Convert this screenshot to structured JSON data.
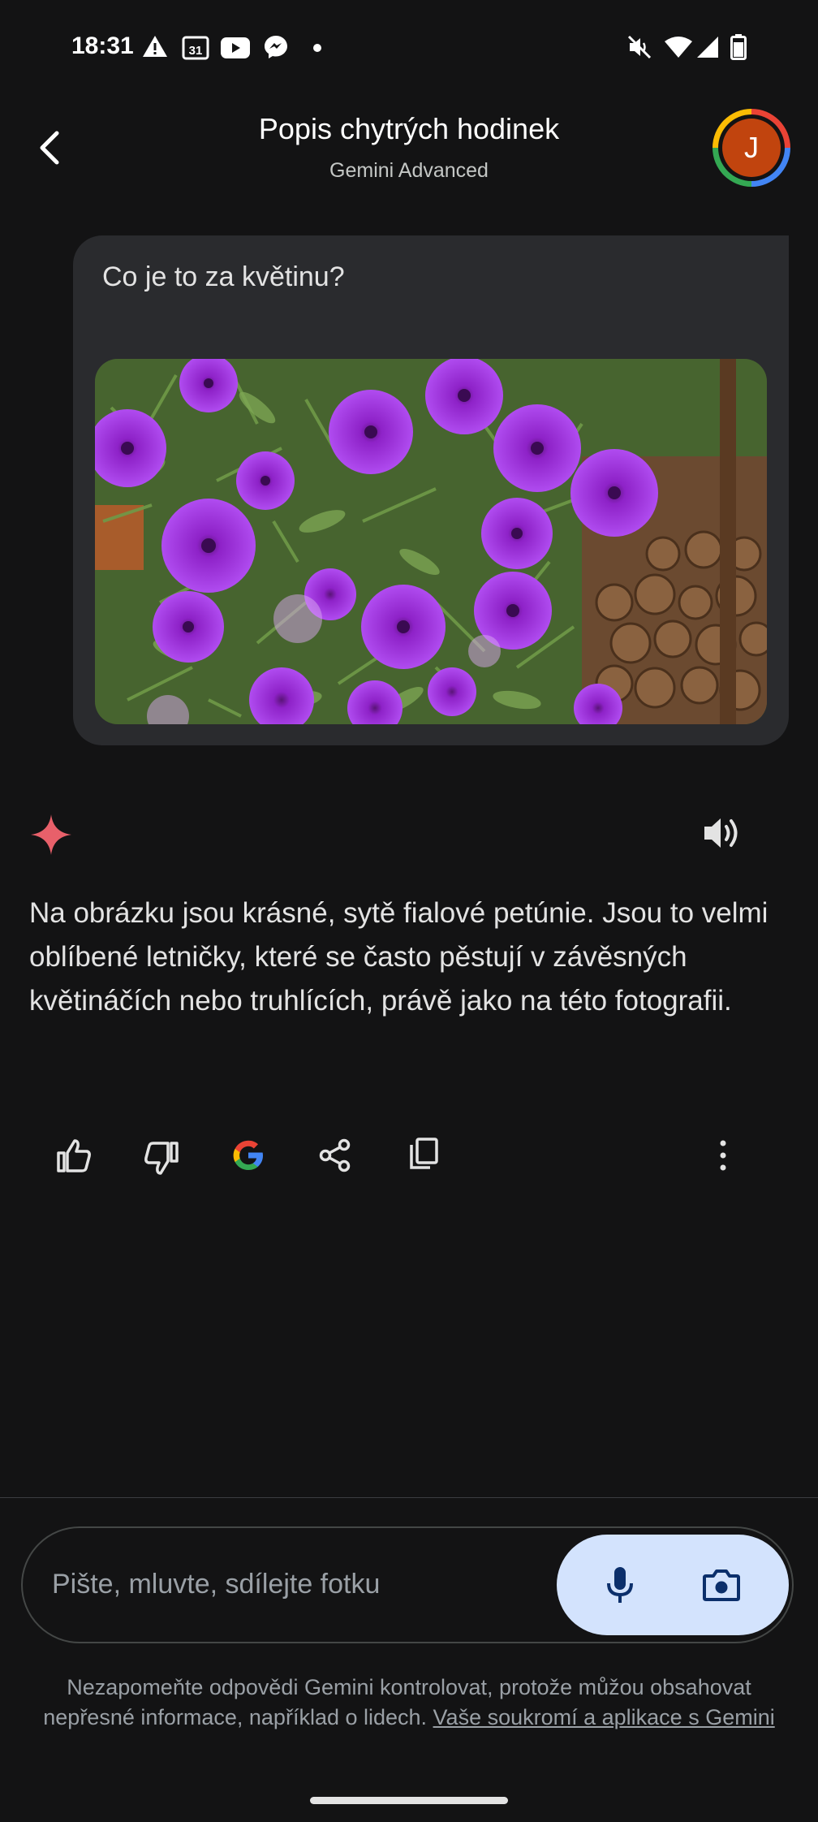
{
  "status_bar": {
    "time": "18:31",
    "calendar_day": "31",
    "left_icons": [
      "warning-icon",
      "calendar-icon",
      "youtube-icon",
      "messenger-icon",
      "dot-icon"
    ],
    "right_icons": [
      "mute-icon",
      "wifi-icon",
      "signal-icon",
      "battery-icon"
    ]
  },
  "header": {
    "title": "Popis chytrých hodinek",
    "subtitle": "Gemini Advanced",
    "avatar_initial": "J"
  },
  "user_message": {
    "text": "Co je to za květinu?",
    "image": "photo of purple petunias"
  },
  "response": {
    "text": "Na obrázku jsou krásné, sytě fialové petúnie. Jsou to velmi oblíbené letničky, které se často pěstují v závěsných květináčích nebo truhlících, právě jako na této fotografii."
  },
  "response_actions": [
    "thumb-up-icon",
    "thumb-down-icon",
    "google-icon",
    "share-icon",
    "copy-icon",
    "more-icon"
  ],
  "input": {
    "placeholder": "Pište, mluvte, sdílejte fotku"
  },
  "disclaimer": {
    "text": "Nezapomeňte odpovědi Gemini kontrolovat, protože můžou obsahovat nepřesné informace, například o lidech. ",
    "link": "Vaše soukromí a aplikace s Gemini"
  },
  "colors": {
    "background": "#131314",
    "bubble": "#2a2b2e",
    "gemini_spark": "#e8606a",
    "action_pill": "#d3e3fd",
    "action_icon": "#0b2f6b",
    "avatar": "#c1440e"
  }
}
